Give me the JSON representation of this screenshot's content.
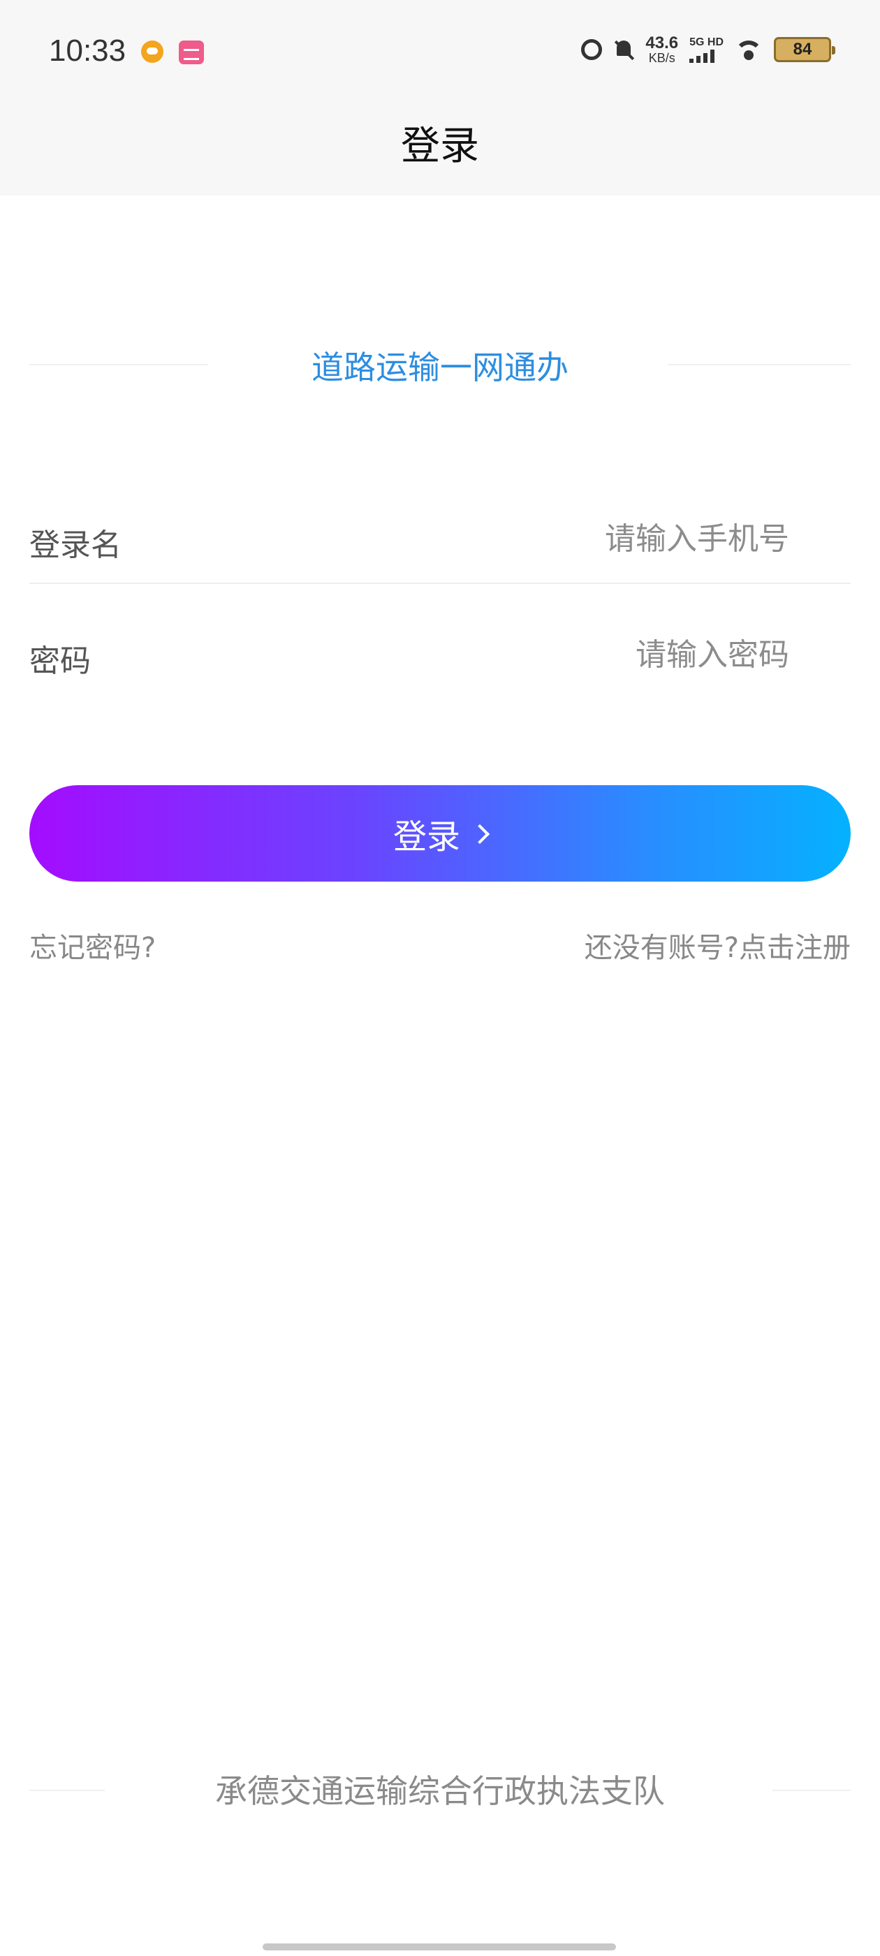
{
  "status_bar": {
    "time": "10:33",
    "net_speed_value": "43.6",
    "net_speed_unit": "KB/s",
    "signal_label": "5G HD",
    "battery": "84"
  },
  "header": {
    "title": "登录"
  },
  "brand": {
    "title": "道路运输一网通办"
  },
  "form": {
    "username_label": "登录名",
    "username_placeholder": "请输入手机号",
    "password_label": "密码",
    "password_placeholder": "请输入密码"
  },
  "actions": {
    "login_label": "登录",
    "forgot_password": "忘记密码?",
    "register": "还没有账号?点击注册"
  },
  "footer": {
    "text": "承德交通运输综合行政执法支队"
  },
  "colors": {
    "brand_blue": "#2d8ee0",
    "gradient_start": "#a40cff",
    "gradient_end": "#05b1ff"
  }
}
